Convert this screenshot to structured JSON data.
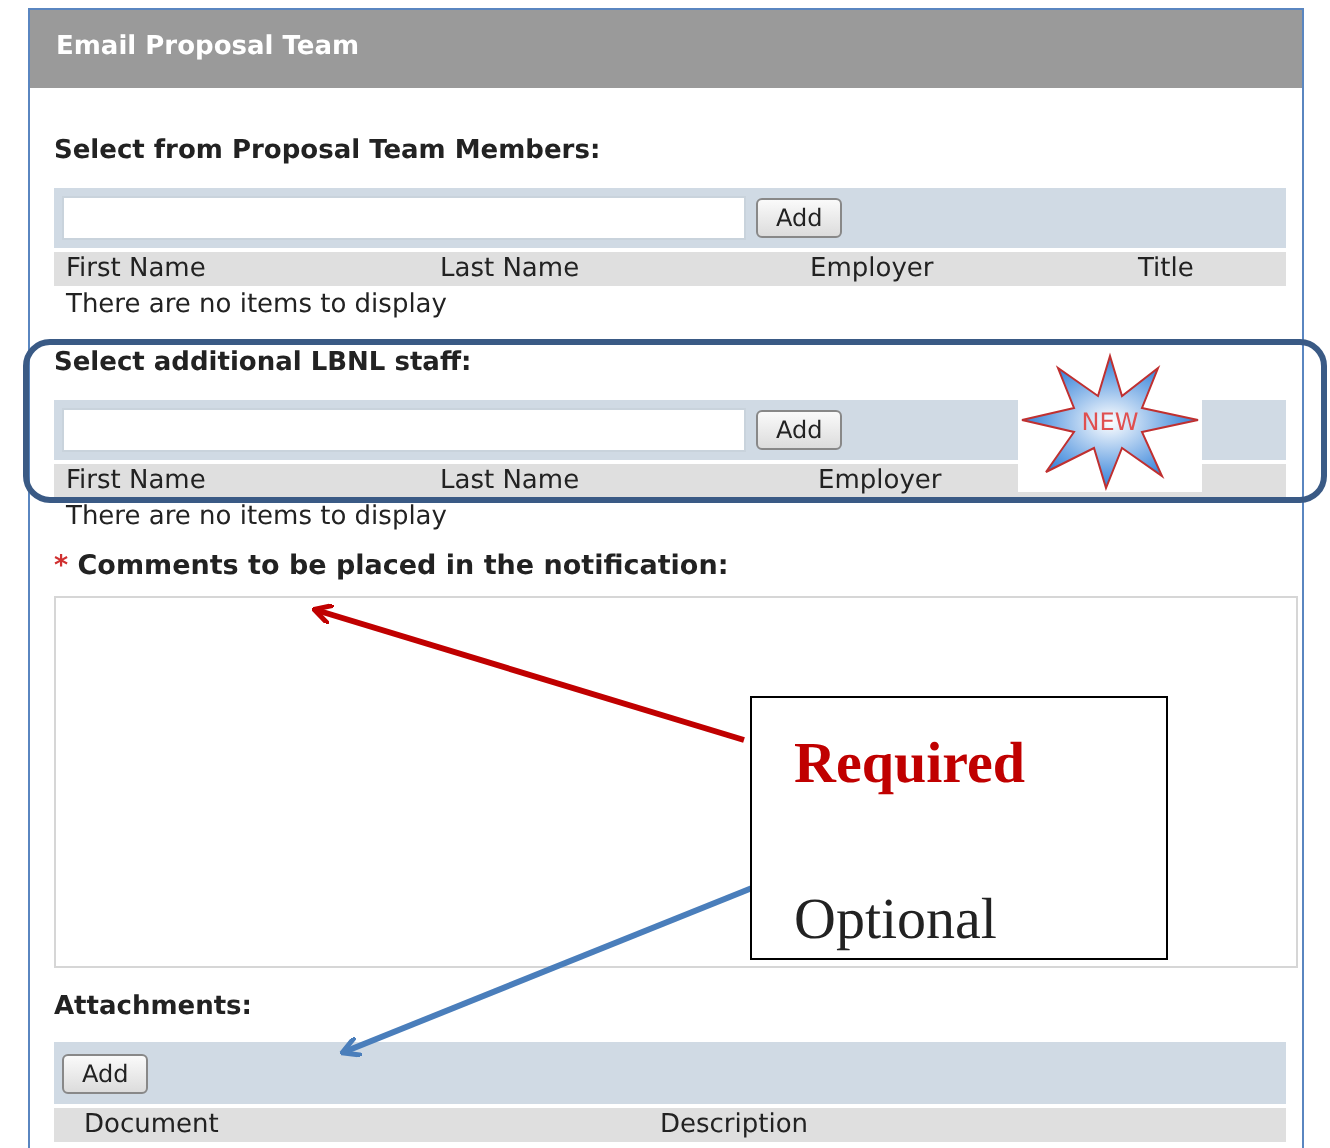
{
  "panel": {
    "title": "Email Proposal Team"
  },
  "sections": [
    {
      "kind": "picker",
      "label": "Select from Proposal Team Members:",
      "button": "Add",
      "columns": [
        "First Name",
        "Last Name",
        "Employer",
        "Title"
      ],
      "empty": "There are no items to display"
    },
    {
      "kind": "picker",
      "label": "Select additional LBNL staff:",
      "button": "Add",
      "columns": [
        "First Name",
        "Last Name",
        "Employer"
      ],
      "empty": "There are no items to display",
      "badge": "NEW"
    },
    {
      "kind": "comments",
      "required_mark": "*",
      "label": "Comments to be placed in the notification:"
    },
    {
      "kind": "attachments",
      "label": "Attachments:",
      "button": "Add",
      "columns": [
        "Document",
        "Description"
      ]
    }
  ],
  "callout": {
    "lines": [
      {
        "text": "Required",
        "kind": "required"
      },
      {
        "text": "Optional",
        "kind": "optional"
      }
    ]
  }
}
